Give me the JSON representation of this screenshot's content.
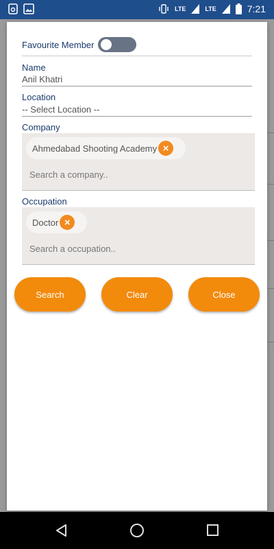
{
  "status_bar": {
    "network_label_1": "LTE",
    "network_label_2": "LTE",
    "time": "7:21"
  },
  "dialog": {
    "favourite": {
      "label": "Favourite Member",
      "enabled": false
    },
    "name": {
      "label": "Name",
      "value": "Anil Khatri"
    },
    "location": {
      "label": "Location",
      "value": "-- Select Location --"
    },
    "company": {
      "label": "Company",
      "chips": [
        "Ahmedabad Shooting Academy"
      ],
      "placeholder": "Search a company.."
    },
    "occupation": {
      "label": "Occupation",
      "chips": [
        "Doctor"
      ],
      "placeholder": "Search a occupation.."
    },
    "buttons": {
      "search": "Search",
      "clear": "Clear",
      "close": "Close"
    }
  },
  "colors": {
    "accent": "#f28a0c",
    "label_blue": "#1b3a6b",
    "status_bar": "#1f4e8c"
  }
}
